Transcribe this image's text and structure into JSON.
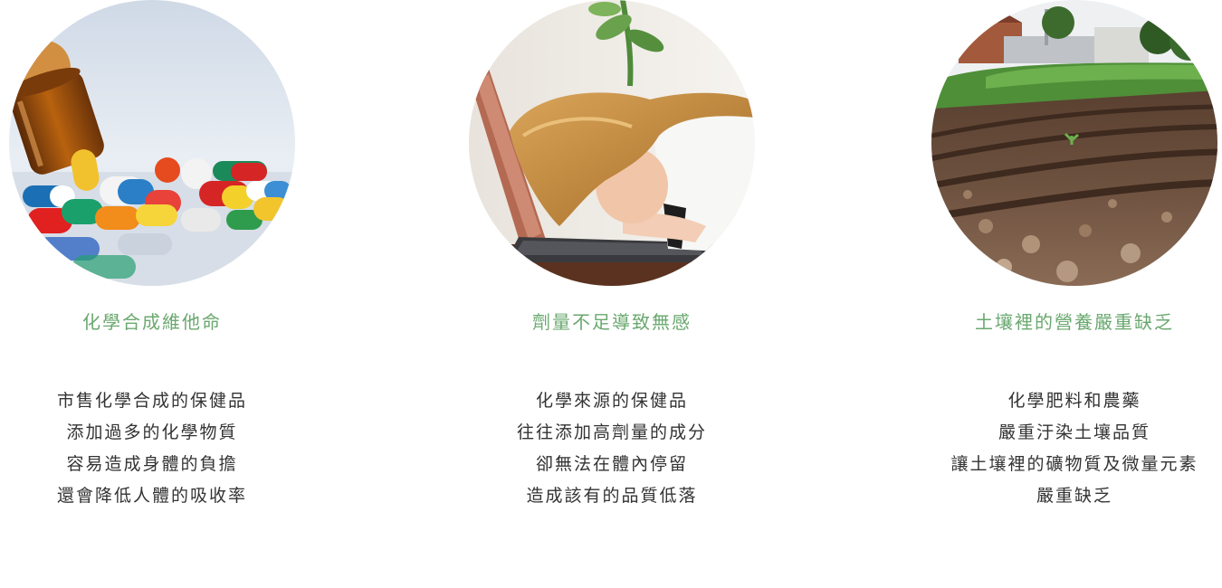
{
  "colors": {
    "heading": "#6aa86f",
    "body_text": "#333333"
  },
  "columns": [
    {
      "image_icon": "pills-photo",
      "title": "化學合成維他命",
      "lines": [
        "市售化學合成的保健品",
        "添加過多的化學物質",
        "容易造成身體的負擔",
        "還會降低人體的吸收率"
      ]
    },
    {
      "image_icon": "tired-worker-photo",
      "title": "劑量不足導致無感",
      "lines": [
        "化學來源的保健品",
        "往往添加高劑量的成分",
        "卻無法在體內停留",
        "造成該有的品質低落"
      ]
    },
    {
      "image_icon": "farmland-soil-photo",
      "title": "土壤裡的營養嚴重缺乏",
      "lines": [
        "化學肥料和農藥",
        "嚴重汙染土壤品質",
        "讓土壤裡的礦物質及微量元素",
        "嚴重缺乏"
      ]
    }
  ]
}
